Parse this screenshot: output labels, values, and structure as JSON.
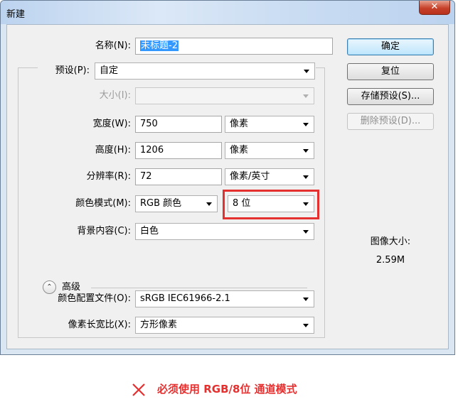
{
  "window": {
    "title": "新建"
  },
  "form": {
    "name": {
      "label": "名称(N):",
      "value": "未标题-2"
    },
    "preset": {
      "label": "预设(P):",
      "value": "自定"
    },
    "size": {
      "label": "大小(I):",
      "value": ""
    },
    "width": {
      "label": "宽度(W):",
      "value": "750",
      "unit": "像素"
    },
    "height": {
      "label": "高度(H):",
      "value": "1206",
      "unit": "像素"
    },
    "resolution": {
      "label": "分辨率(R):",
      "value": "72",
      "unit": "像素/英寸"
    },
    "color_mode": {
      "label": "颜色模式(M):",
      "value": "RGB 颜色",
      "bit_depth": "8 位"
    },
    "background": {
      "label": "背景内容(C):",
      "value": "白色"
    },
    "advanced": {
      "label": "高级"
    },
    "color_profile": {
      "label": "颜色配置文件(O):",
      "value": "sRGB IEC61966-2.1"
    },
    "pixel_aspect": {
      "label": "像素长宽比(X):",
      "value": "方形像素"
    }
  },
  "buttons": {
    "ok": "确定",
    "reset": "复位",
    "save_preset": "存储预设(S)...",
    "delete_preset": "删除预设(D)..."
  },
  "image_size": {
    "label": "图像大小:",
    "value": "2.59M"
  },
  "footer": {
    "message": "必须使用 RGB/8位 通道模式"
  },
  "colors": {
    "highlight": "#e53030",
    "selection": "#3399ff",
    "default_button": "#bee6fd"
  },
  "icons": {
    "close": "close-icon",
    "advanced": "chevron-up-circle-icon",
    "error": "x-mark-icon"
  }
}
